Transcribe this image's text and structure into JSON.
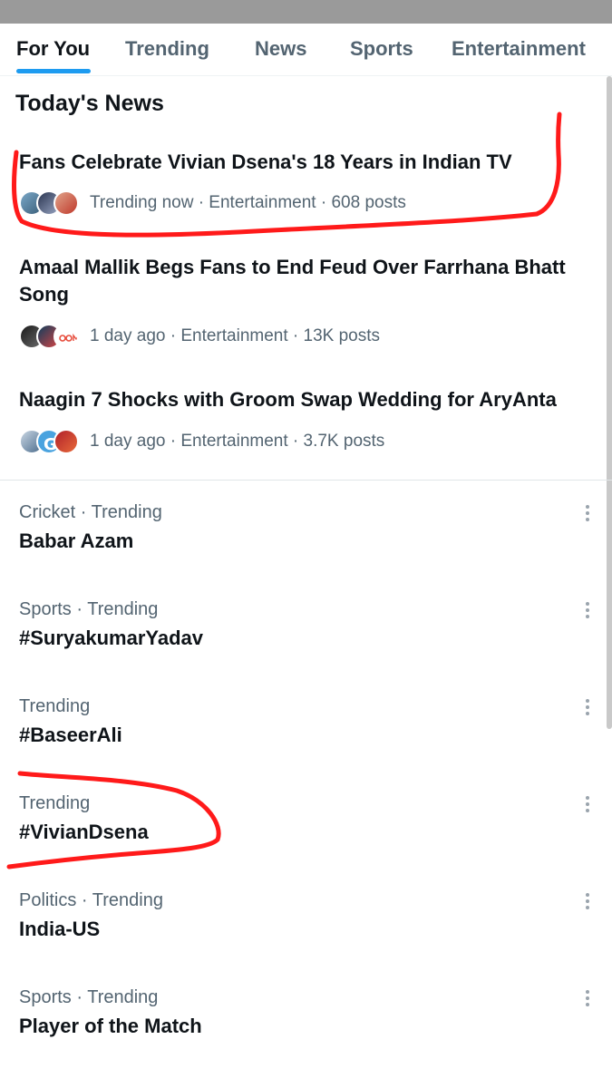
{
  "tabs": [
    {
      "label": "For You",
      "active": true
    },
    {
      "label": "Trending",
      "active": false
    },
    {
      "label": "News",
      "active": false
    },
    {
      "label": "Sports",
      "active": false
    },
    {
      "label": "Entertainment",
      "active": false
    }
  ],
  "section_title": "Today's News",
  "news": [
    {
      "headline": "Fans Celebrate Vivian Dsena's 18 Years in Indian TV",
      "meta": "Trending now · Entertainment · 608 posts"
    },
    {
      "headline": "Amaal Mallik Begs Fans to End Feud Over Farrhana Bhatt Song",
      "meta": "1 day ago · Entertainment · 13K posts"
    },
    {
      "headline": "Naagin 7 Shocks with Groom Swap Wedding for AryAnta",
      "meta": "1 day ago · Entertainment · 3.7K posts"
    }
  ],
  "trends": [
    {
      "context": "Cricket · Trending",
      "name": "Babar Azam"
    },
    {
      "context": "Sports · Trending",
      "name": "#SuryakumarYadav"
    },
    {
      "context": "Trending",
      "name": "#BaseerAli"
    },
    {
      "context": "Trending",
      "name": "#VivianDsena"
    },
    {
      "context": "Politics · Trending",
      "name": "India-US"
    },
    {
      "context": "Sports · Trending",
      "name": "Player of the Match"
    }
  ],
  "colors": {
    "accent": "#1d9bf0",
    "annotation": "#ff1a1a",
    "secondary_text": "#536471",
    "primary_text": "#0f1419"
  }
}
